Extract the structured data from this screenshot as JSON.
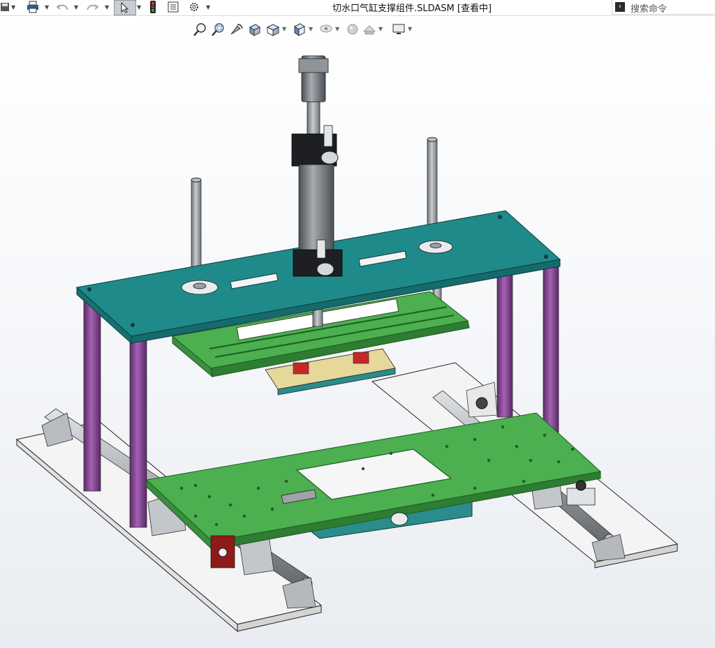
{
  "window": {
    "title": "切水口气缸支撑组件.SLDASM [查看中]"
  },
  "toolbar": {
    "buttons": [
      "save-icon",
      "print-icon",
      "undo-icon",
      "redo-icon",
      "select-icon",
      "traffic-light-icon",
      "file-properties-icon",
      "options-gear-icon"
    ]
  },
  "search": {
    "placeholder": "搜索命令"
  },
  "headsup_toolbar": {
    "tools": [
      "zoom-to-fit-icon",
      "zoom-to-area-icon",
      "previous-view-icon",
      "section-view-icon",
      "view-orientation-icon",
      "display-style-icon",
      "hide-show-items-icon",
      "edit-appearance-icon",
      "apply-scene-icon",
      "view-settings-icon"
    ]
  },
  "colors": {
    "top_plate": "#1f8a8a",
    "green_plate": "#4caf50",
    "posts": "#8e4a9c",
    "base_plates": "#f4f4f4",
    "rods": "#9aa0a6",
    "cylinder": "#6f747a"
  }
}
